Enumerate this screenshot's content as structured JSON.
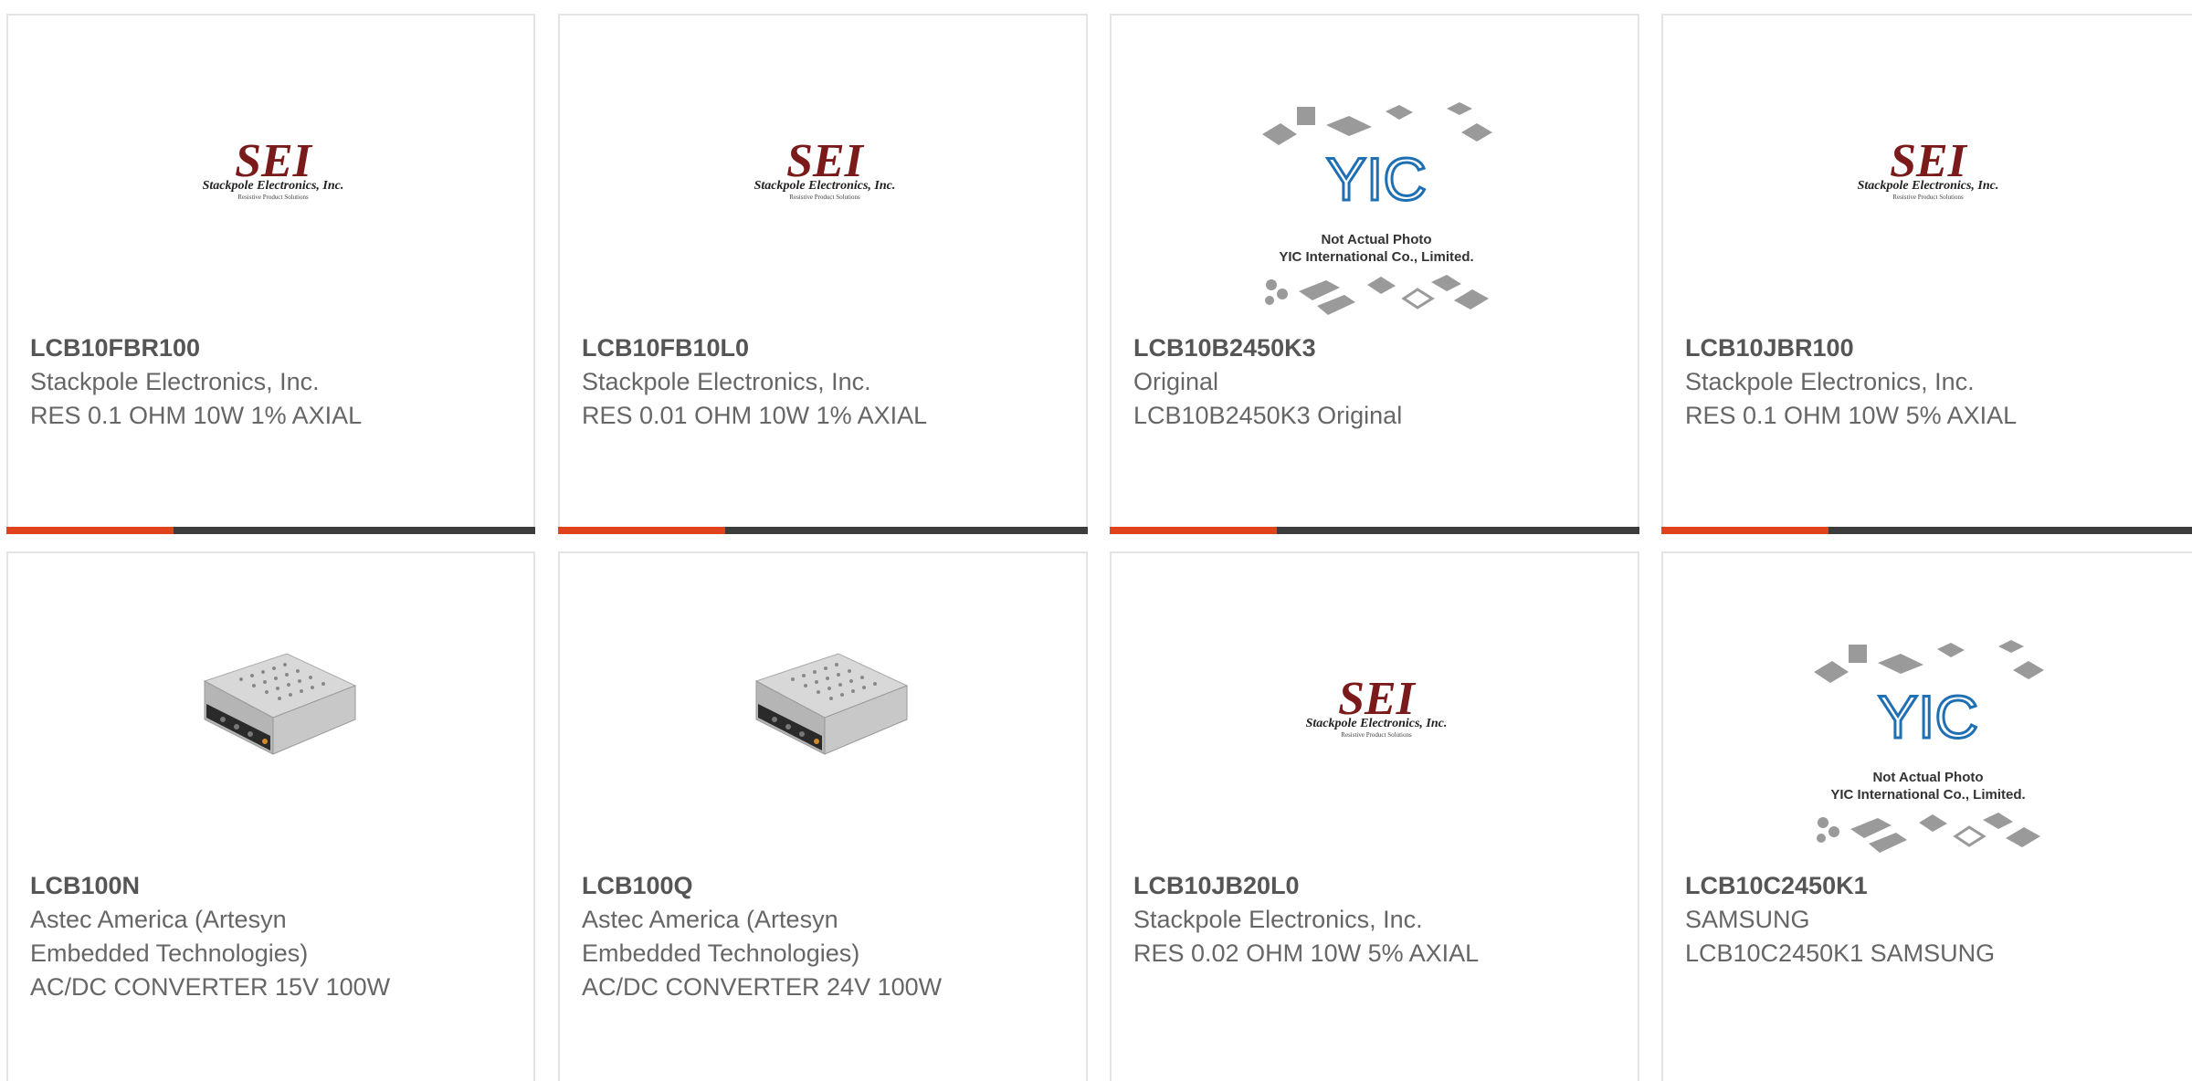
{
  "theme": {
    "accent": "#e0431c",
    "bar": "#3c3c3c",
    "border": "#e4e4e4",
    "text": "#666666"
  },
  "products": [
    {
      "part": "LCB10FBR100",
      "manufacturer": "Stackpole Electronics, Inc.",
      "description": "RES 0.1 OHM 10W 1% AXIAL",
      "image": "sei-logo"
    },
    {
      "part": "LCB10FB10L0",
      "manufacturer": "Stackpole Electronics, Inc.",
      "description": "RES 0.01 OHM 10W 1% AXIAL",
      "image": "sei-logo"
    },
    {
      "part": "LCB10B2450K3",
      "manufacturer": "Original",
      "description": "LCB10B2450K3 Original",
      "image": "yic-placeholder"
    },
    {
      "part": "LCB10JBR100",
      "manufacturer": "Stackpole Electronics, Inc.",
      "description": "RES 0.1 OHM 10W 5% AXIAL",
      "image": "sei-logo"
    },
    {
      "part": "LCB100N",
      "manufacturer": "Astec America (Artesyn Embedded Technologies)",
      "description": "AC/DC CONVERTER 15V 100W",
      "image": "power-supply-photo"
    },
    {
      "part": "LCB100Q",
      "manufacturer": "Astec America (Artesyn Embedded Technologies)",
      "description": "AC/DC CONVERTER 24V 100W",
      "image": "power-supply-photo"
    },
    {
      "part": "LCB10JB20L0",
      "manufacturer": "Stackpole Electronics, Inc.",
      "description": "RES 0.02 OHM 10W 5% AXIAL",
      "image": "sei-logo"
    },
    {
      "part": "LCB10C2450K1",
      "manufacturer": "SAMSUNG",
      "description": "LCB10C2450K1 SAMSUNG",
      "image": "yic-placeholder"
    }
  ],
  "logos": {
    "sei": {
      "mark": "SEI",
      "name": "Stackpole Electronics, Inc.",
      "tagline": "Resistive Product Solutions"
    },
    "yic": {
      "mark": "YIC",
      "line1": "Not Actual Photo",
      "line2": "YIC International Co., Limited."
    }
  }
}
